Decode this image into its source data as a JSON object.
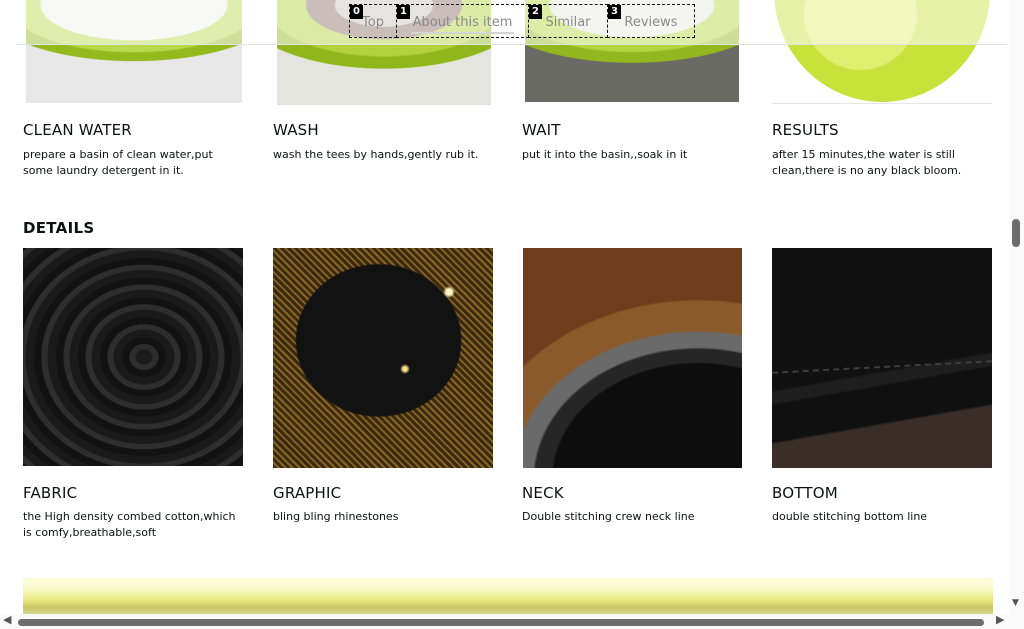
{
  "tabs": [
    {
      "num": "0",
      "label": "Top"
    },
    {
      "num": "1",
      "label": "About this item"
    },
    {
      "num": "2",
      "label": "Similar"
    },
    {
      "num": "3",
      "label": "Reviews"
    }
  ],
  "washing": [
    {
      "title": "CLEAN WATER",
      "text": "prepare a basin of clean water,put some laundry detergent in it."
    },
    {
      "title": "WASH",
      "text": "wash the tees by hands,gently rub it."
    },
    {
      "title": "WAIT",
      "text": "put it into the basin,,soak in it"
    },
    {
      "title": "RESULTS",
      "text": "after 15 minutes,the water is still clean,there is no any black bloom."
    }
  ],
  "details": {
    "heading": "DETAILS",
    "items": [
      {
        "title": "FABRIC",
        "text": "the High density combed cotton,which is comfy,breathable,soft"
      },
      {
        "title": "GRAPHIC",
        "text": "bling bling rhinestones"
      },
      {
        "title": "NECK",
        "text": "Double stitching crew neck line"
      },
      {
        "title": "BOTTOM",
        "text": "double stitching bottom line"
      }
    ]
  },
  "icons": {
    "scroll_up": "caret-up-icon",
    "scroll_down": "caret-down-icon",
    "scroll_left": "caret-left-icon",
    "scroll_right": "caret-right-icon"
  },
  "colors": {
    "accent_green": "#b4d63c",
    "text": "#0f1111"
  }
}
